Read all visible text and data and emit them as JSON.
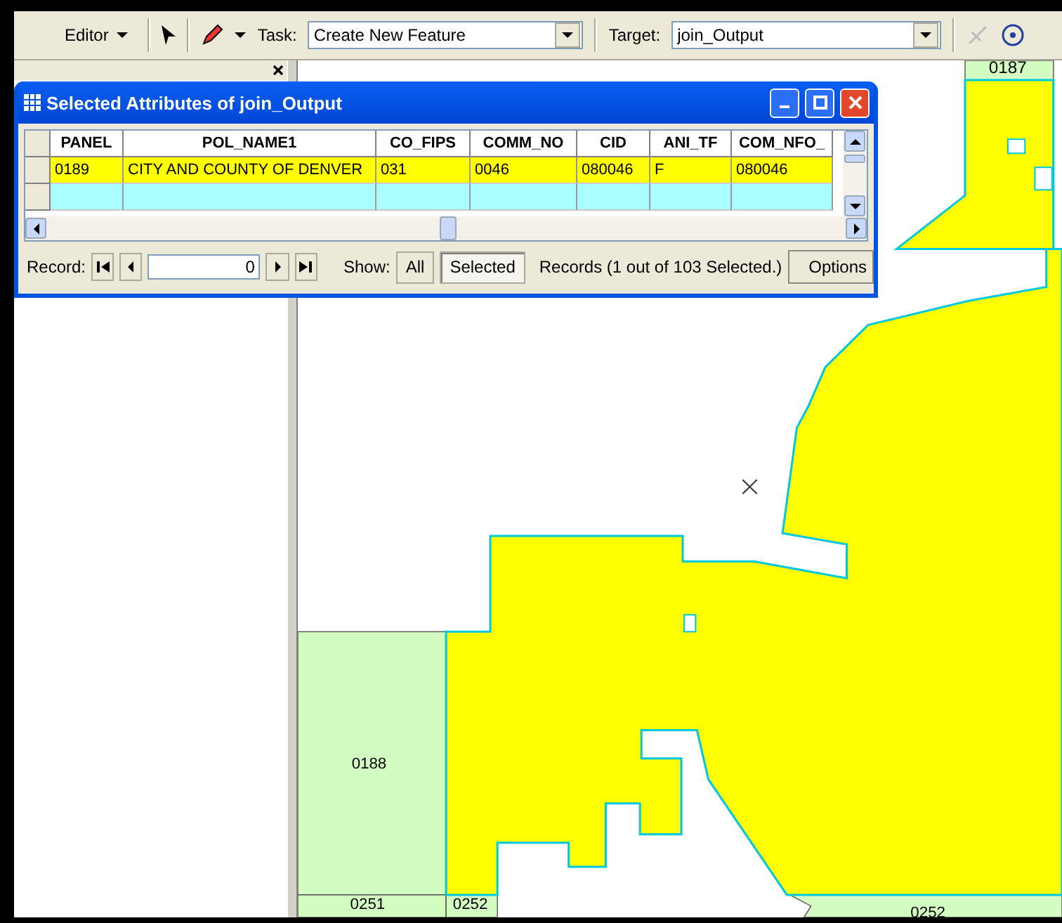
{
  "toolbar": {
    "editor_menu": "Editor",
    "task_label": "Task:",
    "task_value": "Create New Feature",
    "target_label": "Target:",
    "target_value": "join_Output"
  },
  "attributes_window": {
    "title": "Selected Attributes of join_Output",
    "columns": [
      "PANEL",
      "POL_NAME1",
      "CO_FIPS",
      "COMM_NO",
      "CID",
      "ANI_TF",
      "COM_NFO_"
    ],
    "rows": [
      {
        "cells": [
          "0189",
          "CITY AND COUNTY OF DENVER",
          "031",
          "0046",
          "080046",
          "F",
          "080046"
        ],
        "selected": true
      },
      {
        "cells": [],
        "selected": false
      }
    ],
    "footer": {
      "record_label": "Record:",
      "record_value": "0",
      "show_label": "Show:",
      "show_buttons": [
        {
          "label": "All",
          "selected": false
        },
        {
          "label": "Selected",
          "selected": true
        }
      ],
      "records_text": "Records  (1 out of 103 Selected.)",
      "options_button": "Options"
    }
  },
  "map": {
    "labels": [
      "0187",
      "0188",
      "0251",
      "0252",
      "0252"
    ]
  }
}
